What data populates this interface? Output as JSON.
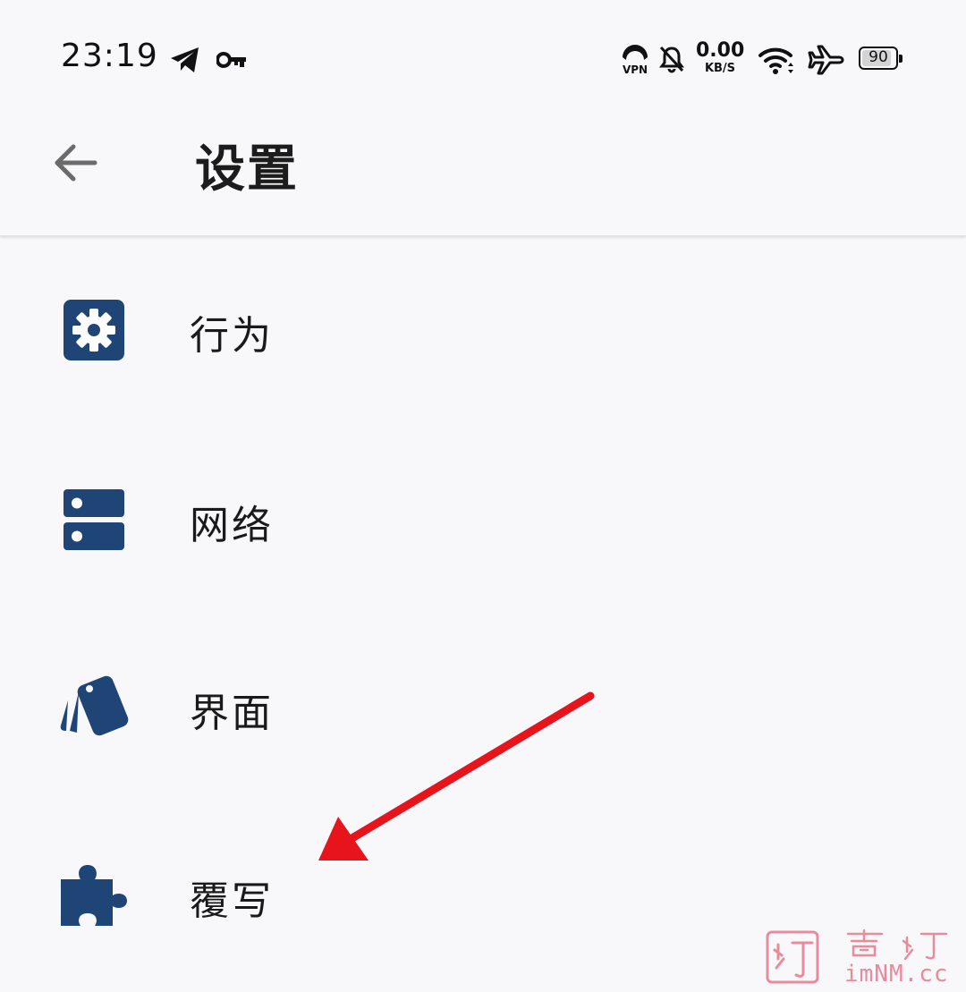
{
  "status_bar": {
    "time": "23:19",
    "net_speed_value": "0.00",
    "net_speed_unit": "KB/S",
    "battery_level": "90",
    "battery_fraction": 0.9,
    "icons": [
      "telegram-icon",
      "key-icon",
      "vpn-icon",
      "bell-off-icon",
      "wifi-icon",
      "airplane-icon",
      "battery-icon"
    ]
  },
  "header": {
    "title": "设置",
    "back_icon": "arrow-left-icon"
  },
  "settings": {
    "items": [
      {
        "label": "行为",
        "icon": "gear-icon"
      },
      {
        "label": "网络",
        "icon": "server-icon"
      },
      {
        "label": "界面",
        "icon": "swatchbook-icon"
      },
      {
        "label": "覆写",
        "icon": "puzzle-icon"
      }
    ]
  },
  "watermark": {
    "site": "imNM.cc"
  },
  "colors": {
    "accent": "#1f4576",
    "background": "#f8f8fa",
    "arrow": "#e8141b",
    "watermark": "#e98b9d"
  }
}
